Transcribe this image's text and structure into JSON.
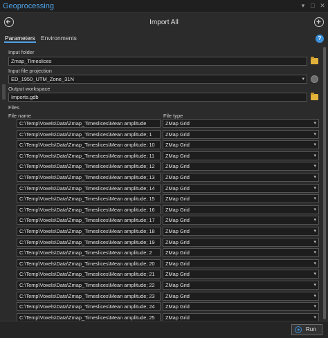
{
  "window": {
    "title": "Geoprocessing",
    "controls": [
      "▾",
      "□",
      "✕"
    ]
  },
  "header": {
    "tool_title": "Import All"
  },
  "tabs": [
    {
      "label": "Parameters",
      "active": true
    },
    {
      "label": "Environments",
      "active": false
    }
  ],
  "params": {
    "input_folder": {
      "label": "Input folder",
      "value": "Zmap_Timeslices"
    },
    "input_projection": {
      "label": "Input file projection",
      "value": "ED_1950_UTM_Zone_31N"
    },
    "output_workspace": {
      "label": "Output workspace",
      "value": "Imports.gdb"
    },
    "files": {
      "label": "Files",
      "col_file_name": "File name",
      "col_file_type": "File type",
      "rows": [
        {
          "path": "C:\\Temp\\Voxels\\Data\\Zmap_Timeslices\\Mean amplitude",
          "type": "ZMap Grid"
        },
        {
          "path": "C:\\Temp\\Voxels\\Data\\Zmap_Timeslices\\Mean amplitude; 1",
          "type": "ZMap Grid"
        },
        {
          "path": "C:\\Temp\\Voxels\\Data\\Zmap_Timeslices\\Mean amplitude; 10",
          "type": "ZMap Grid"
        },
        {
          "path": "C:\\Temp\\Voxels\\Data\\Zmap_Timeslices\\Mean amplitude; 11",
          "type": "ZMap Grid"
        },
        {
          "path": "C:\\Temp\\Voxels\\Data\\Zmap_Timeslices\\Mean amplitude; 12",
          "type": "ZMap Grid"
        },
        {
          "path": "C:\\Temp\\Voxels\\Data\\Zmap_Timeslices\\Mean amplitude; 13",
          "type": "ZMap Grid"
        },
        {
          "path": "C:\\Temp\\Voxels\\Data\\Zmap_Timeslices\\Mean amplitude; 14",
          "type": "ZMap Grid"
        },
        {
          "path": "C:\\Temp\\Voxels\\Data\\Zmap_Timeslices\\Mean amplitude; 15",
          "type": "ZMap Grid"
        },
        {
          "path": "C:\\Temp\\Voxels\\Data\\Zmap_Timeslices\\Mean amplitude; 16",
          "type": "ZMap Grid"
        },
        {
          "path": "C:\\Temp\\Voxels\\Data\\Zmap_Timeslices\\Mean amplitude; 17",
          "type": "ZMap Grid"
        },
        {
          "path": "C:\\Temp\\Voxels\\Data\\Zmap_Timeslices\\Mean amplitude; 18",
          "type": "ZMap Grid"
        },
        {
          "path": "C:\\Temp\\Voxels\\Data\\Zmap_Timeslices\\Mean amplitude; 19",
          "type": "ZMap Grid"
        },
        {
          "path": "C:\\Temp\\Voxels\\Data\\Zmap_Timeslices\\Mean amplitude; 2",
          "type": "ZMap Grid"
        },
        {
          "path": "C:\\Temp\\Voxels\\Data\\Zmap_Timeslices\\Mean amplitude; 20",
          "type": "ZMap Grid"
        },
        {
          "path": "C:\\Temp\\Voxels\\Data\\Zmap_Timeslices\\Mean amplitude; 21",
          "type": "ZMap Grid"
        },
        {
          "path": "C:\\Temp\\Voxels\\Data\\Zmap_Timeslices\\Mean amplitude; 22",
          "type": "ZMap Grid"
        },
        {
          "path": "C:\\Temp\\Voxels\\Data\\Zmap_Timeslices\\Mean amplitude; 23",
          "type": "ZMap Grid"
        },
        {
          "path": "C:\\Temp\\Voxels\\Data\\Zmap_Timeslices\\Mean amplitude; 24",
          "type": "ZMap Grid"
        },
        {
          "path": "C:\\Temp\\Voxels\\Data\\Zmap_Timeslices\\Mean amplitude; 25",
          "type": "ZMap Grid"
        },
        {
          "path": "C:\\Temp\\Voxels\\Data\\Zmap_Timeslices\\Mean amplitude; 26",
          "type": "ZMap Grid"
        }
      ]
    }
  },
  "footer": {
    "run_label": "Run"
  },
  "colors": {
    "accent": "#4fa3e8",
    "background": "#2b2b2b",
    "folder": "#e2b23a"
  }
}
